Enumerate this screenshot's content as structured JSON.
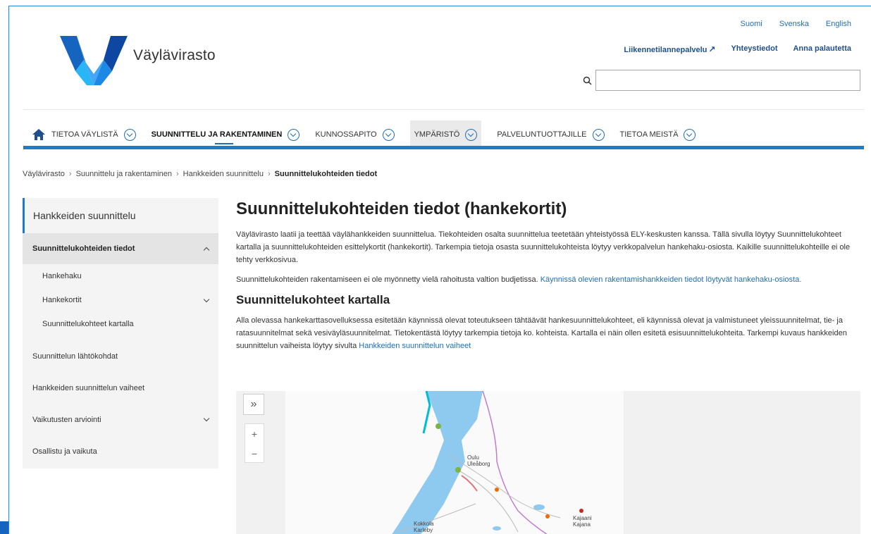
{
  "site": {
    "brand": "Väylävirasto"
  },
  "langs": [
    "Suomi",
    "Svenska",
    "English"
  ],
  "top_links": {
    "traffic": "Liikennetilannepalvelu",
    "contact": "Yhteystiedot",
    "feedback": "Anna palautetta"
  },
  "search": {
    "placeholder": ""
  },
  "nav": {
    "items": [
      "TIETOA VÄYLISTÄ",
      "SUUNNITTELU JA RAKENTAMINEN",
      "KUNNOSSAPITO",
      "YMPÄRISTÖ",
      "PALVELUNTUOTTAJILLE",
      "TIETOA MEISTÄ"
    ]
  },
  "breadcrumb": {
    "items": [
      "Väylävirasto",
      "Suunnittelu ja rakentaminen",
      "Hankkeiden suunnittelu"
    ],
    "current": "Suunnittelukohteiden tiedot"
  },
  "sidebar": {
    "head": "Hankkeiden suunnittelu",
    "active": "Suunnittelukohteiden tiedot",
    "sub": [
      "Hankehaku",
      "Hankekortit",
      "Suunnittelukohteet kartalla"
    ],
    "items": [
      "Suunnittelun lähtökohdat",
      "Hankkeiden suunnittelun vaiheet",
      "Vaikutusten arviointi",
      "Osallistu ja vaikuta"
    ]
  },
  "content": {
    "title": "Suunnittelukohteiden tiedot (hankekortit)",
    "p1": "Väylävirasto laatii ja teettää väylähankkeiden suunnittelua. Tiekohteiden osalta suunnittelua teetetään yhteistyössä ELY-keskusten kanssa. Tällä sivulla löytyy Suunnittelukohteet kartalla ja suunnittelukohteiden esittelykortit (hankekortit). Tarkempia tietoja osasta suunnittelukohteista löytyy verkkopalvelun hankehaku-osiosta. Kaikille suunnittelukohteille ei ole tehty verkkosivua.",
    "p2_text": "Suunnittelukohteiden rakentamiseen ei ole myönnetty vielä rahoitusta valtion budjetissa. ",
    "p2_link": "Käynnissä olevien rakentamishankkeiden tiedot löytyvät hankehaku-osiosta.",
    "h2": "Suunnittelukohteet kartalla",
    "p3_text": "Alla olevassa hankekarttasovelluksessa esitetään käynnissä olevat toteutukseen tähtäävät hankesuunnittelukohteet, eli käynnissä olevat ja valmistuneet yleissuunnitelmat, tie- ja ratasuunnitelmat sekä vesiväyläsuunnitelmat. Tietokentästä löytyy tarkempia tietoja ko. kohteista. Kartalla ei näin ollen esitetä esisuunnittelukohteita. Tarkempi kuvaus hankkeiden suunnittelun vaiheista löytyy sivulta ",
    "p3_link": "Hankkeiden suunnittelun vaiheet"
  },
  "map": {
    "toggle": "»",
    "zoom_in": "+",
    "zoom_out": "−",
    "labels": {
      "oulu": "Oulu\nUleåborg",
      "kokkola": "Kokkola\nKarleby",
      "kajaani": "Kajaani\nKajana"
    }
  },
  "colors": {
    "accent": "#1f7ac7",
    "link": "#1f6fb5",
    "sea": "#8ecaf0"
  }
}
